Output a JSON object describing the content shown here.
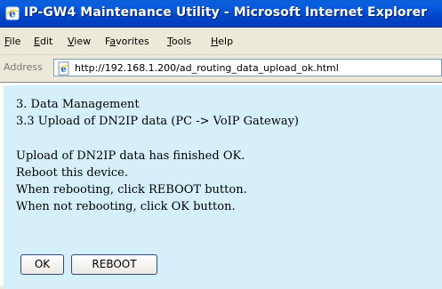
{
  "window": {
    "title": "IP-GW4 Maintenance Utility - Microsoft Internet Explorer",
    "app_icon": "internet-explorer-icon"
  },
  "menu": {
    "items": [
      {
        "label": "File",
        "accel": "F"
      },
      {
        "label": "Edit",
        "accel": "E"
      },
      {
        "label": "View",
        "accel": "V"
      },
      {
        "label": "Favorites",
        "accel": "a"
      },
      {
        "label": "Tools",
        "accel": "T"
      },
      {
        "label": "Help",
        "accel": "H"
      }
    ]
  },
  "address": {
    "label": "Address",
    "url": "http://192.168.1.200/ad_routing_data_upload_ok.html",
    "page_icon": "ie-page-icon"
  },
  "page": {
    "heading": "3. Data Management",
    "subheading": "3.3 Upload of DN2IP data (PC -> VoIP Gateway)",
    "messages": [
      "Upload of DN2IP data has finished OK.",
      "Reboot this device.",
      "When rebooting, click REBOOT button.",
      "When not rebooting, click OK button."
    ],
    "ok_label": "OK",
    "reboot_label": "REBOOT",
    "background": "#d6f0fb"
  }
}
